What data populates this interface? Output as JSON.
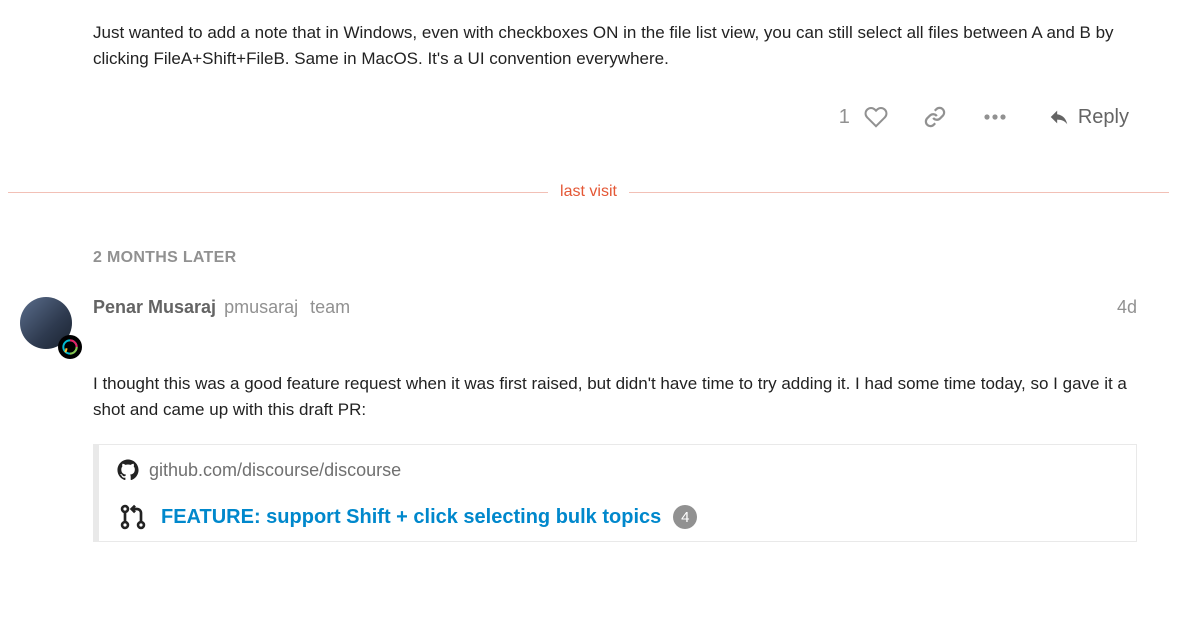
{
  "post1": {
    "body": "Just wanted to add a note that in Windows, even with checkboxes ON in the file list view, you can still select all files between A and B by clicking FileA+Shift+FileB. Same in MacOS. It's a UI convention everywhere.",
    "like_count": "1",
    "reply_label": "Reply"
  },
  "divider": {
    "last_visit": "last visit",
    "time_gap": "2 MONTHS LATER"
  },
  "post2": {
    "author_fullname": "Penar Musaraj",
    "author_username": "pmusaraj",
    "author_title": "team",
    "age": "4d",
    "body": "I thought this was a good feature request when it was first raised, but didn't have time to try adding it. I had some time today, so I gave it a shot and came up with this draft PR:"
  },
  "onebox": {
    "source": "github.com/discourse/discourse",
    "title": "FEATURE: support Shift + click selecting bulk topics",
    "badge": "4"
  }
}
